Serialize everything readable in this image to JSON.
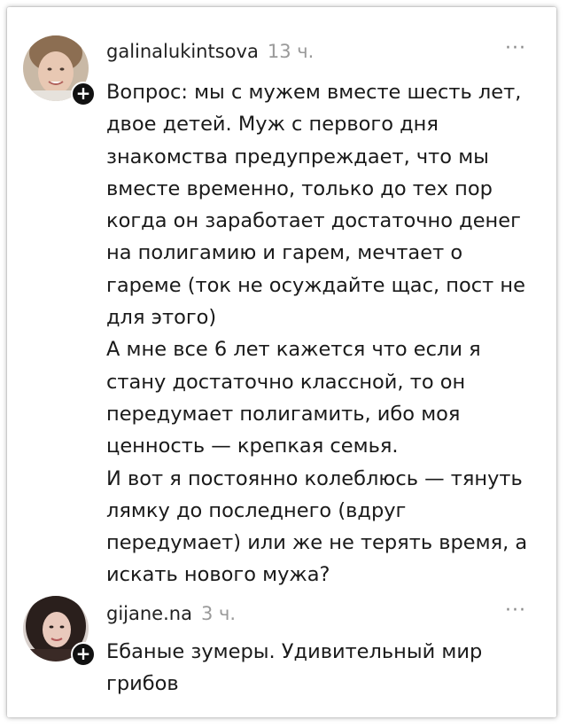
{
  "comments": [
    {
      "username": "galinalukintsova",
      "time": "13 ч.",
      "more": "···",
      "lines": [
        "Вопрос: мы с мужем вместе шесть лет,",
        "двое детей. Муж с первого дня",
        "знакомства предупреждает, что мы",
        "вместе временно, только до тех пор",
        "когда он заработает достаточно денег",
        "на полигамию и гарем, мечтает о",
        "гареме (ток не осуждайте щас, пост не",
        "для этого)",
        "А мне все 6 лет кажется что если я",
        "стану достаточно классной, то он",
        "передумает полигамить, ибо моя",
        "ценность — крепкая семья.",
        "И вот я постоянно колеблюсь — тянуть",
        "лямку до последнего (вдруг",
        "передумает) или же не терять время, а",
        "искать нового мужа?"
      ]
    },
    {
      "username": "gijane.na",
      "time": "3 ч.",
      "more": "···",
      "lines": [
        "Ебаные зумеры. Удивительный мир",
        "грибов"
      ]
    }
  ],
  "plus_icon": "+",
  "colors": {
    "text": "#1a1a1a",
    "muted": "#9a9a9a",
    "plus_badge": "#111111"
  }
}
